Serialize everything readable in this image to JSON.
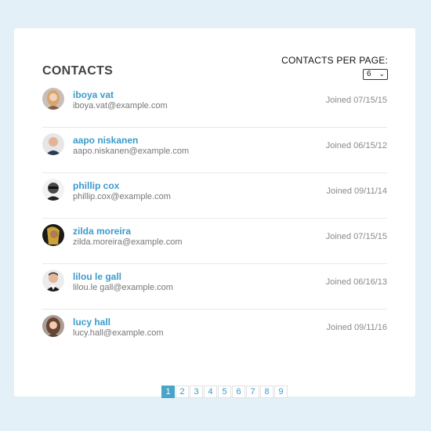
{
  "header": {
    "title": "CONTACTS",
    "per_page_label": "CONTACTS PER PAGE:",
    "per_page_value": "6"
  },
  "contacts": [
    {
      "name": "iboya vat",
      "email": "iboya.vat@example.com",
      "joined": "Joined 07/15/15",
      "avatar": "avatar-woman-blonde"
    },
    {
      "name": "aapo niskanen",
      "email": "aapo.niskanen@example.com",
      "joined": "Joined 06/15/12",
      "avatar": "avatar-man-bald"
    },
    {
      "name": "phillip cox",
      "email": "phillip.cox@example.com",
      "joined": "Joined 09/11/14",
      "avatar": "avatar-man-glasses"
    },
    {
      "name": "zilda moreira",
      "email": "zilda.moreira@example.com",
      "joined": "Joined 07/15/15",
      "avatar": "avatar-woman-dark"
    },
    {
      "name": "lilou le gall",
      "email": "lilou.le gall@example.com",
      "joined": "Joined 06/16/13",
      "avatar": "avatar-man-smiling"
    },
    {
      "name": "lucy hall",
      "email": "lucy.hall@example.com",
      "joined": "Joined 09/11/16",
      "avatar": "avatar-woman-brown"
    }
  ],
  "pagination": {
    "pages": [
      "1",
      "2",
      "3",
      "4",
      "5",
      "6",
      "7",
      "8",
      "9"
    ],
    "current": "1"
  },
  "colors": {
    "background": "#e3f0f7",
    "accent": "#3a9bcc",
    "active_page": "#4aa3c8"
  }
}
